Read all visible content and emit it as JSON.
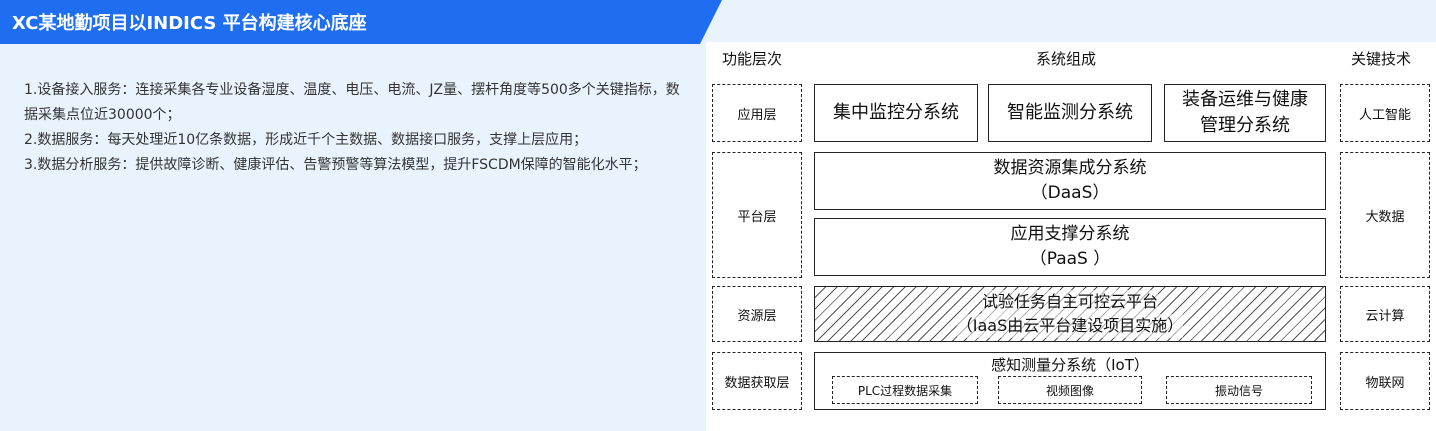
{
  "banner": {
    "title": "XC某地勤项目以INDICS 平台构建核心底座"
  },
  "text": {
    "lines": [
      "1.设备接入服务：连接采集各专业设备湿度、温度、电压、电流、JZ量、摆杆角度等500多个关键指标，数据采集点位近30000个；",
      "2.数据服务：每天处理近10亿条数据，形成近千个主数据、数据接口服务，支撑上层应用；",
      "3.数据分析服务：提供故障诊断、健康评估、告警预警等算法模型，提升FSCDM保障的智能化水平；"
    ]
  },
  "diagram": {
    "headers": {
      "left": "功能层次",
      "center": "系统组成",
      "right": "关键技术"
    },
    "layers": {
      "app": "应用层",
      "platform": "平台层",
      "resource": "资源层",
      "data": "数据获取层"
    },
    "tech": {
      "app": "人工智能",
      "platform": "大数据",
      "resource": "云计算",
      "data": "物联网"
    },
    "app_systems": {
      "s1": "集中监控分系统",
      "s2": "智能监测分系统",
      "s3_line1": "装备运维与健康",
      "s3_line2": "管理分系统"
    },
    "daas": {
      "line1": "数据资源集成分系统",
      "line2": "（DaaS）"
    },
    "paas": {
      "line1": "应用支撑分系统",
      "line2": "（PaaS ）"
    },
    "iaas": {
      "line1": "试验任务自主可控云平台",
      "line2": "（IaaS由云平台建设项目实施）"
    },
    "iot": {
      "title": "感知测量分系统（IoT）",
      "items": [
        "PLC过程数据采集",
        "视频图像",
        "振动信号"
      ]
    }
  }
}
